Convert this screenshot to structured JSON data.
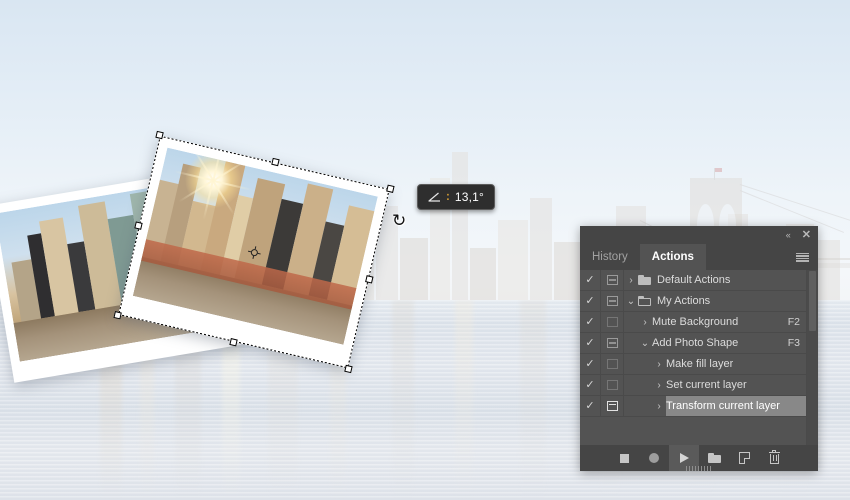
{
  "app": {
    "scene_description": "Photoshop canvas with New York City skyline background and two photo layers"
  },
  "canvas": {
    "angle_hud": {
      "icon": "angle-icon",
      "separator": ":",
      "value": "13,1°"
    },
    "rotate_cursor": "↻",
    "transform_handle_count": 8
  },
  "panel": {
    "collapse_icon": "«",
    "close_icon": "✕",
    "menu_icon": "hamburger-icon",
    "tabs": [
      {
        "label": "History",
        "active": false
      },
      {
        "label": "Actions",
        "active": true
      }
    ],
    "rows": [
      {
        "checked": "✓",
        "toggle": "minus",
        "arrow": "›",
        "folder": "closed",
        "label": "Default Actions",
        "shortcut": "",
        "indent": 0,
        "selected": false
      },
      {
        "checked": "✓",
        "toggle": "minus",
        "arrow": "⌄",
        "folder": "open",
        "label": "My Actions",
        "shortcut": "",
        "indent": 0,
        "selected": false
      },
      {
        "checked": "✓",
        "toggle": "empty",
        "arrow": "›",
        "folder": "none",
        "label": "Mute Background",
        "shortcut": "F2",
        "indent": 1,
        "selected": false
      },
      {
        "checked": "✓",
        "toggle": "minus",
        "arrow": "⌄",
        "folder": "none",
        "label": "Add Photo Shape",
        "shortcut": "F3",
        "indent": 1,
        "selected": false
      },
      {
        "checked": "✓",
        "toggle": "empty",
        "arrow": "›",
        "folder": "none",
        "label": "Make fill layer",
        "shortcut": "",
        "indent": 2,
        "selected": false
      },
      {
        "checked": "✓",
        "toggle": "empty",
        "arrow": "›",
        "folder": "none",
        "label": "Set current layer",
        "shortcut": "",
        "indent": 2,
        "selected": false
      },
      {
        "checked": "✓",
        "toggle": "modal",
        "arrow": "›",
        "folder": "none",
        "label": "Transform current layer",
        "shortcut": "",
        "indent": 2,
        "selected": true
      }
    ],
    "bottom_buttons": [
      {
        "name": "stop-playing-recording",
        "icon": "stop-icon",
        "active": false
      },
      {
        "name": "begin-recording",
        "icon": "record-icon",
        "active": false
      },
      {
        "name": "play-selection",
        "icon": "play-icon",
        "active": true
      },
      {
        "name": "create-new-set",
        "icon": "folder-icon",
        "active": false
      },
      {
        "name": "create-new-action",
        "icon": "new-page-icon",
        "active": false
      },
      {
        "name": "delete",
        "icon": "trash-icon",
        "active": false
      }
    ]
  },
  "colors": {
    "panel_bg": "#535353",
    "panel_chrome": "#454545",
    "selected_row": "#888888",
    "text": "#dcdcdc",
    "hud_bg": "#2e2e2e",
    "hud_accent": "#cf9a33"
  }
}
